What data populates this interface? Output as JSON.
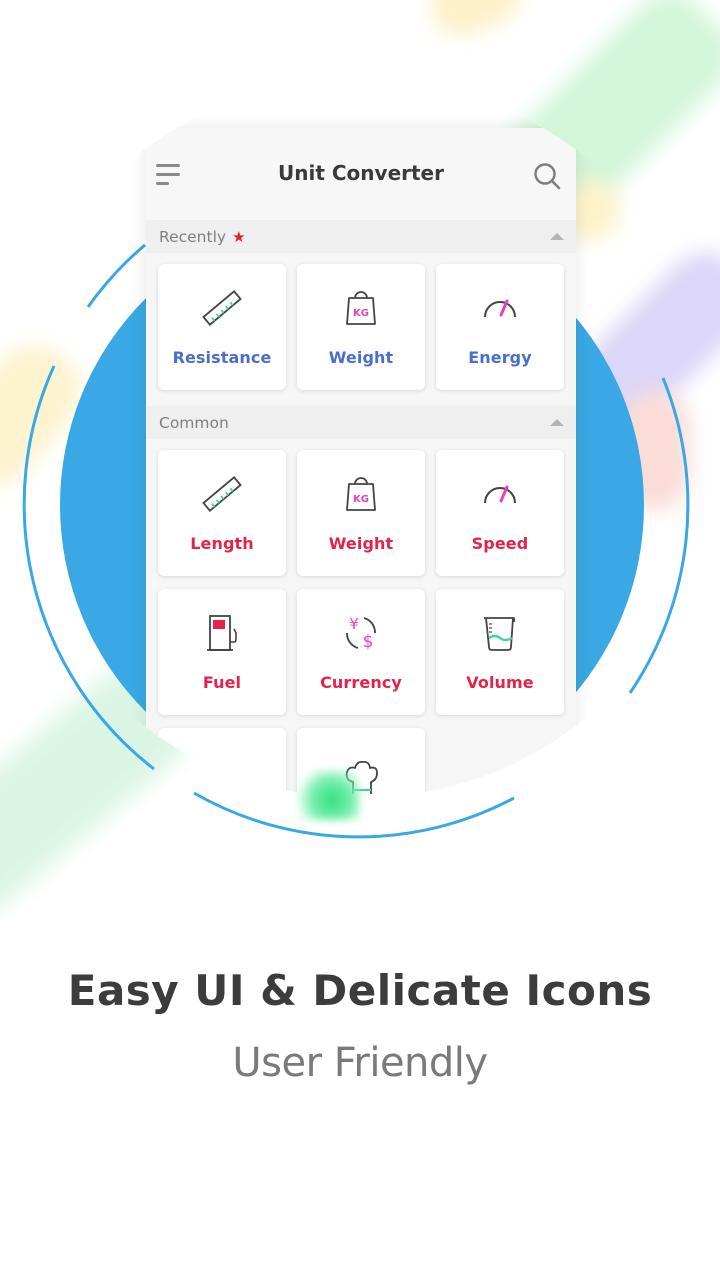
{
  "app": {
    "title": "Unit Converter",
    "menu_icon": "hamburger-menu-icon",
    "search_icon": "search-icon"
  },
  "sections": {
    "recently": {
      "title": "Recently",
      "badge_icon": "star-icon",
      "badge_glyph": "★",
      "items": [
        {
          "label": "Resistance",
          "icon": "ruler-icon"
        },
        {
          "label": "Weight",
          "icon": "kg-weight-icon",
          "icon_text": "KG"
        },
        {
          "label": "Energy",
          "icon": "gauge-icon"
        }
      ]
    },
    "common": {
      "title": "Common",
      "items": [
        {
          "label": "Length",
          "icon": "ruler-icon"
        },
        {
          "label": "Weight",
          "icon": "kg-weight-icon",
          "icon_text": "KG"
        },
        {
          "label": "Speed",
          "icon": "gauge-icon"
        },
        {
          "label": "Fuel",
          "icon": "fuel-pump-icon"
        },
        {
          "label": "Currency",
          "icon": "currency-exchange-icon",
          "icon_text_1": "¥",
          "icon_text_2": "$"
        },
        {
          "label": "Volume",
          "icon": "measuring-cup-icon"
        },
        {
          "label": "",
          "icon": "partially-visible-icon"
        },
        {
          "label": "",
          "icon": "chef-hat-icon"
        }
      ]
    }
  },
  "colors": {
    "recent_label": "#4a6fc8",
    "common_label": "#e5234a",
    "accent_pink": "#e83fc6",
    "accent_green": "#3ed6a0",
    "circle_blue": "#3aa8e4",
    "star_red": "#e8202e"
  },
  "caption": {
    "title": "Easy UI & Delicate Icons",
    "subtitle": "User Friendly"
  }
}
